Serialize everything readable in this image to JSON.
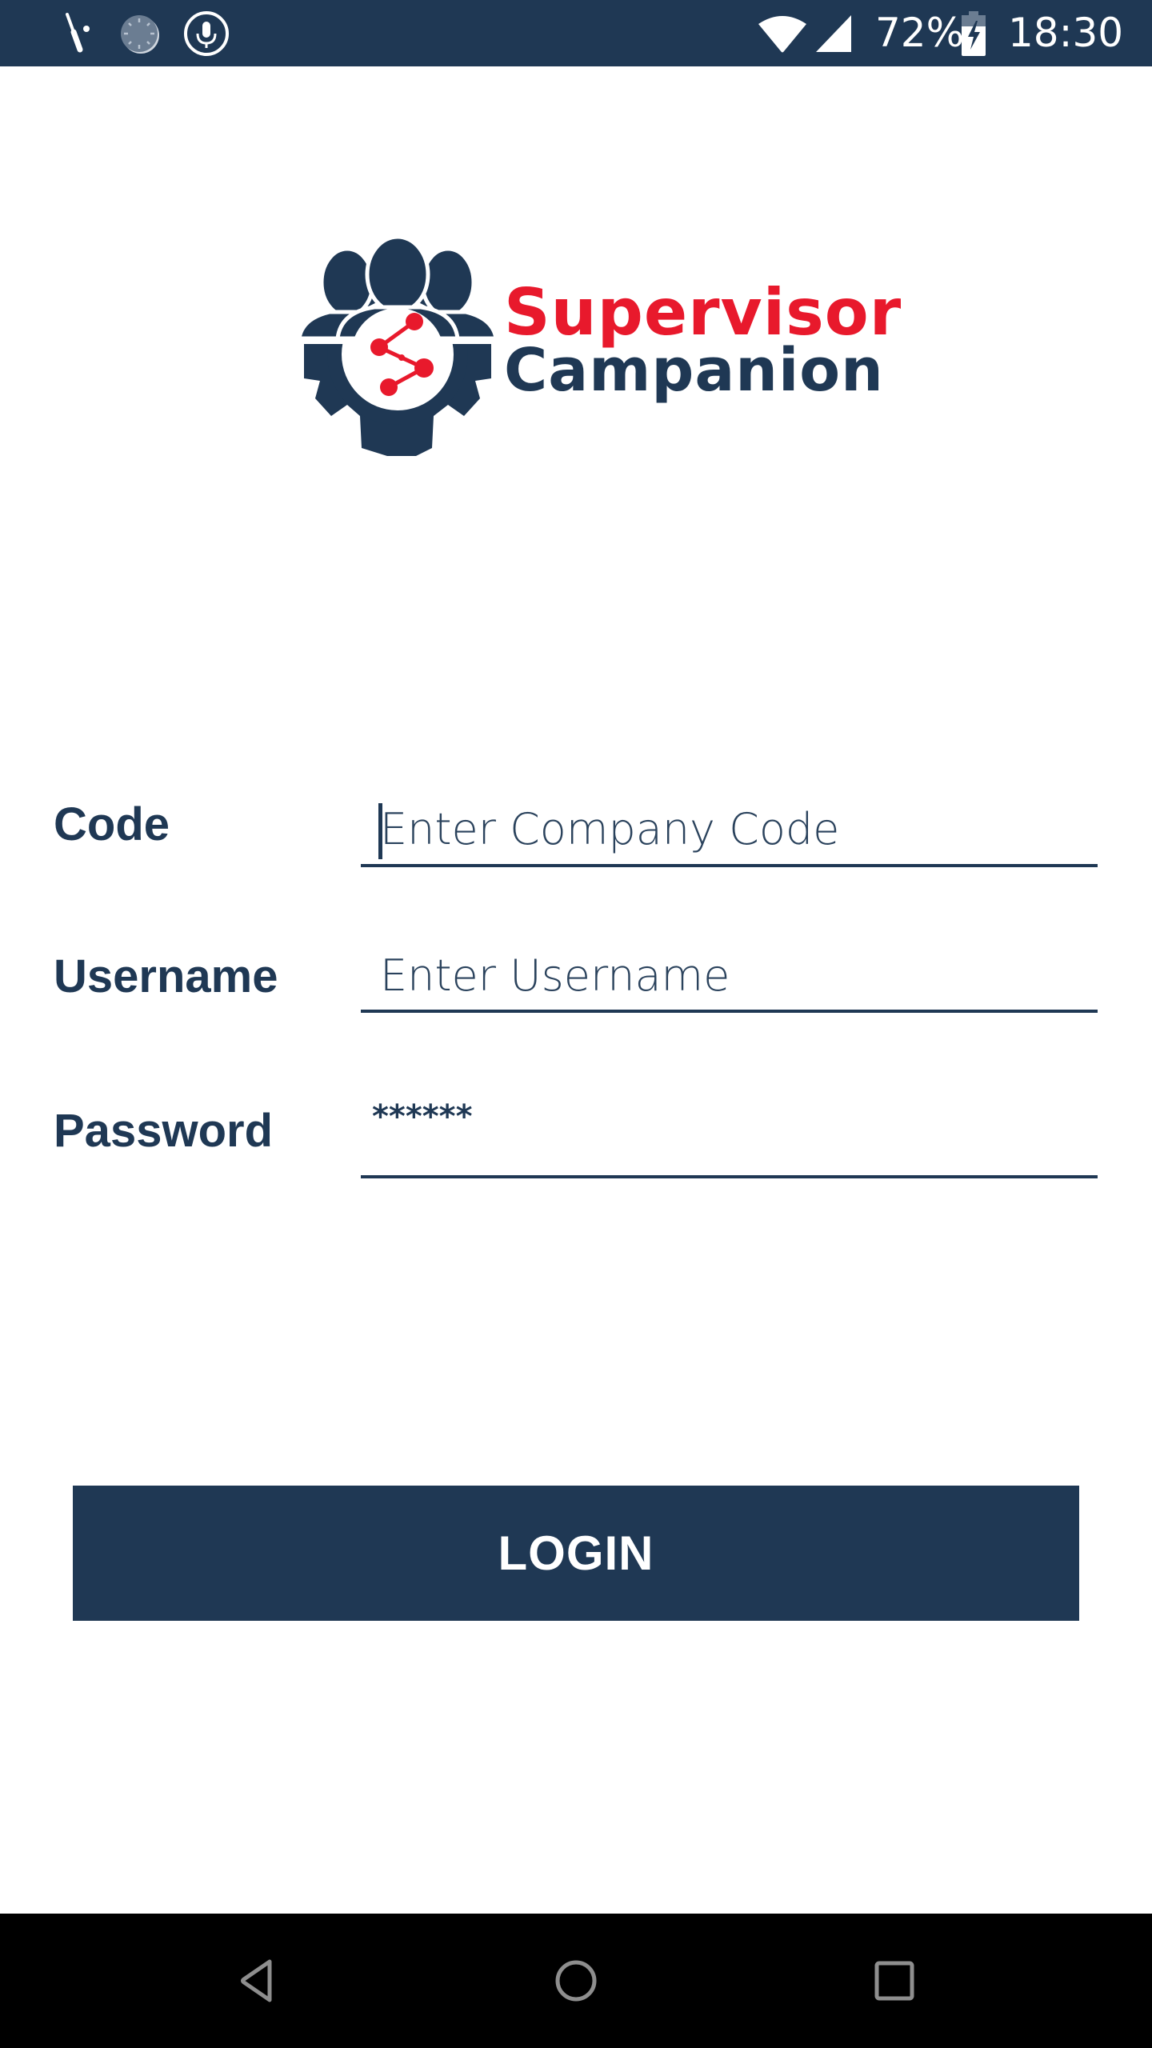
{
  "status_bar": {
    "left_icons": [
      "screwdriver-icon",
      "sync-progress-icon",
      "microphone-icon"
    ],
    "right_icons": [
      "wifi-icon",
      "cellular-signal-icon",
      "battery-charging-icon"
    ],
    "battery_percent": "72%",
    "time": "18:30"
  },
  "logo": {
    "icon": "team-gear-share-icon",
    "line1": "Supervisor",
    "line2": "Campanion",
    "colors": {
      "primary": "#1f3854",
      "accent": "#e8192c"
    }
  },
  "form": {
    "code": {
      "label": "Code",
      "placeholder": "Enter Company Code",
      "value": ""
    },
    "username": {
      "label": "Username",
      "placeholder": "Enter Username",
      "value": ""
    },
    "password": {
      "label": "Password",
      "placeholder": "",
      "value": "******"
    }
  },
  "login_button": {
    "label": "LOGIN"
  },
  "nav_bar": {
    "buttons": [
      "back-icon",
      "home-icon",
      "recents-icon"
    ]
  },
  "theme": {
    "primary": "#1f3854",
    "accent": "#e8192c",
    "background": "#ffffff"
  }
}
